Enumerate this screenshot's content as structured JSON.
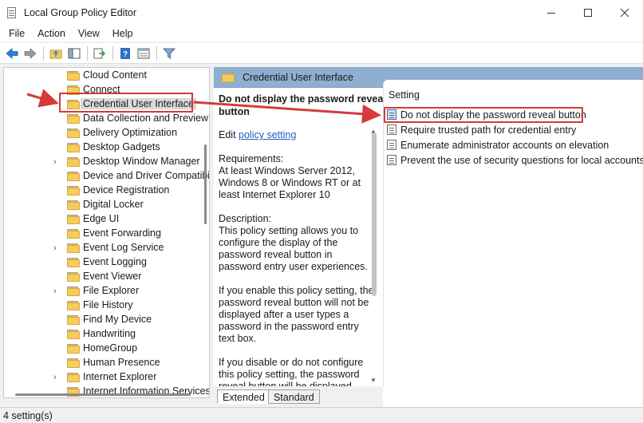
{
  "window": {
    "title": "Local Group Policy Editor",
    "controls": [
      "—",
      "☐",
      "✕"
    ]
  },
  "menu": [
    "File",
    "Action",
    "View",
    "Help"
  ],
  "toolbar": [
    "back-icon",
    "forward-icon",
    "up-folder-icon",
    "show-hide-tree-icon",
    "export-list-icon",
    "help-icon",
    "properties-icon",
    "filter-icon"
  ],
  "tree": {
    "items": [
      {
        "label": "Cloud Content",
        "expandable": false
      },
      {
        "label": "Connect",
        "expandable": false
      },
      {
        "label": "Credential User Interface",
        "expandable": false,
        "selected": true
      },
      {
        "label": "Data Collection and Preview",
        "expandable": false
      },
      {
        "label": "Delivery Optimization",
        "expandable": false
      },
      {
        "label": "Desktop Gadgets",
        "expandable": false
      },
      {
        "label": "Desktop Window Manager",
        "expandable": true
      },
      {
        "label": "Device and Driver Compatibility",
        "expandable": false
      },
      {
        "label": "Device Registration",
        "expandable": false
      },
      {
        "label": "Digital Locker",
        "expandable": false
      },
      {
        "label": "Edge UI",
        "expandable": false
      },
      {
        "label": "Event Forwarding",
        "expandable": false
      },
      {
        "label": "Event Log Service",
        "expandable": true
      },
      {
        "label": "Event Logging",
        "expandable": false
      },
      {
        "label": "Event Viewer",
        "expandable": false
      },
      {
        "label": "File Explorer",
        "expandable": true
      },
      {
        "label": "File History",
        "expandable": false
      },
      {
        "label": "Find My Device",
        "expandable": false
      },
      {
        "label": "Handwriting",
        "expandable": false
      },
      {
        "label": "HomeGroup",
        "expandable": false
      },
      {
        "label": "Human Presence",
        "expandable": false
      },
      {
        "label": "Internet Explorer",
        "expandable": true
      },
      {
        "label": "Internet Information Services",
        "expandable": false
      }
    ]
  },
  "content": {
    "header": "Credential User Interface",
    "description": {
      "title_line1": "Do not display the password reveal",
      "title_line2": "button",
      "edit_prefix": "Edit ",
      "edit_link": "policy setting",
      "requirements": "Requirements:\nAt least Windows Server 2012, Windows 8 or Windows RT or at least Internet Explorer 10",
      "description": "Description:\nThis policy setting allows you to configure the display of the password reveal button in password entry user experiences.",
      "enable_text": "If you enable this policy setting, the password reveal button will not be displayed after a user types a password in the password entry text box.",
      "disable_text": "If you disable or do not configure this policy setting, the password reveal button will be displayed"
    },
    "list": {
      "column": "Setting",
      "rows": [
        {
          "label": "Do not display the password reveal button",
          "selected": true
        },
        {
          "label": "Require trusted path for credential entry"
        },
        {
          "label": "Enumerate administrator accounts on elevation"
        },
        {
          "label": "Prevent the use of security questions for local accounts"
        }
      ]
    },
    "tabs": [
      "Extended",
      "Standard"
    ],
    "active_tab": "Extended"
  },
  "status": "4 setting(s)",
  "colors": {
    "annotation": "#d63a3a",
    "header_bg": "#8faed0",
    "link": "#1f5fbf",
    "folder": "#f5cc5e"
  }
}
